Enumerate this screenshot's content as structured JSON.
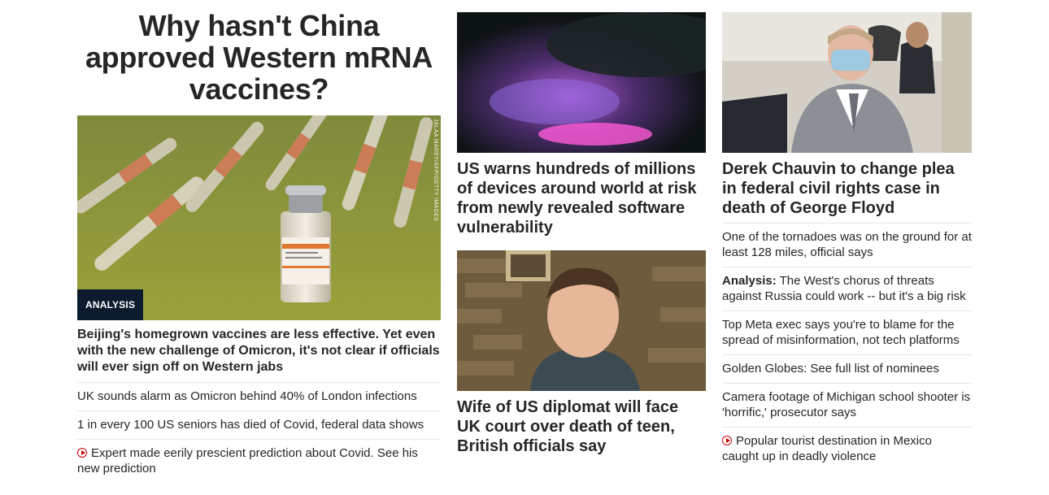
{
  "hero": {
    "title": "Why hasn't China approved Western mRNA vaccines?",
    "badge": "ANALYSIS",
    "credit": "JALAA MAREY/AFP/GETTY IMAGES",
    "subtitle": "Beijing's homegrown vaccines are less effective. Yet even with the new challenge of Omicron, it's not clear if officials will ever sign off on Western jabs",
    "links": [
      {
        "text": "UK sounds alarm as Omicron behind 40% of London infections",
        "video": false
      },
      {
        "text": "1 in every 100 US seniors has died of Covid, federal data shows",
        "video": false
      },
      {
        "text": "Expert made eerily prescient prediction about Covid. See his new prediction",
        "video": true
      }
    ]
  },
  "middle": {
    "story1": "US warns hundreds of millions of devices around world at risk from newly revealed software vulnerability",
    "story2": "Wife of US diplomat will face UK court over death of teen, British officials say"
  },
  "right": {
    "headline": "Derek Chauvin to change plea in federal civil rights case in death of George Floyd",
    "links": [
      {
        "prefix": "",
        "text": "One of the tornadoes was on the ground for at least 128 miles, official says",
        "video": false
      },
      {
        "prefix": "Analysis:",
        "text": " The West's chorus of threats against Russia could work -- but it's a big risk",
        "video": false
      },
      {
        "prefix": "",
        "text": "Top Meta exec says you're to blame for the spread of misinformation, not tech platforms",
        "video": false
      },
      {
        "prefix": "",
        "text": "Golden Globes: See full list of nominees",
        "video": false
      },
      {
        "prefix": "",
        "text": "Camera footage of Michigan school shooter is 'horrific,' prosecutor says",
        "video": false
      },
      {
        "prefix": "",
        "text": "Popular tourist destination in Mexico caught up in deadly violence",
        "video": true
      }
    ]
  },
  "colors": {
    "badge_bg": "#0c1b2e",
    "video_icon": "#cc0000",
    "text": "#262626",
    "divider": "#e6e6e6"
  }
}
